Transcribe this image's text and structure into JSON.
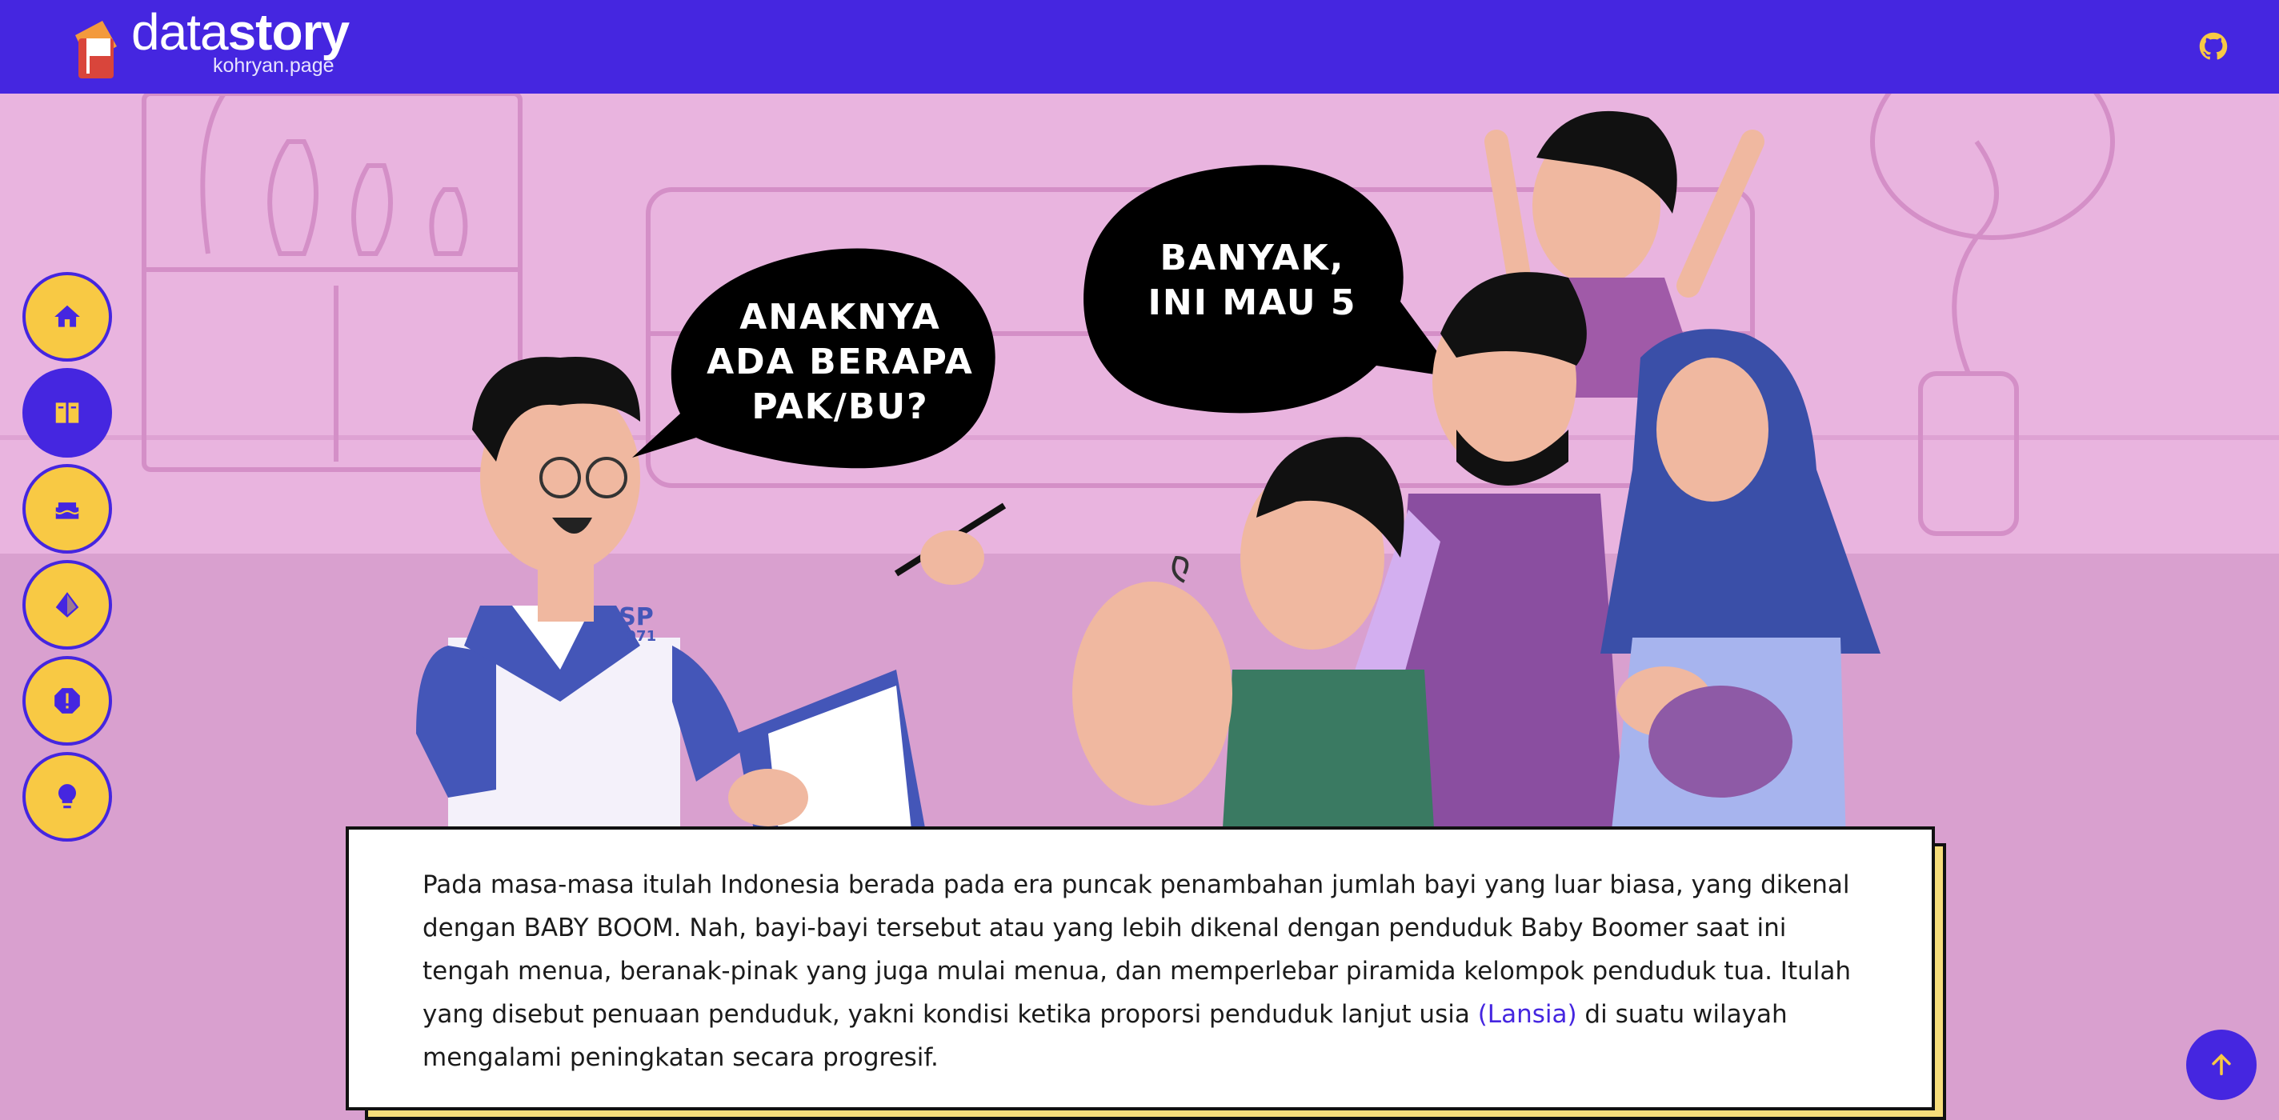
{
  "header": {
    "brand_light": "data",
    "brand_bold": "story",
    "tagline": "kohryan.page",
    "github_icon": "github-icon"
  },
  "nav": {
    "items": [
      {
        "icon": "home-icon",
        "active": false
      },
      {
        "icon": "book-icon",
        "active": true
      },
      {
        "icon": "cake-icon",
        "active": false
      },
      {
        "icon": "pyramid-icon",
        "active": false
      },
      {
        "icon": "alert-icon",
        "active": false
      },
      {
        "icon": "lightbulb-icon",
        "active": false
      }
    ]
  },
  "scene": {
    "bubble_left": "ANAKNYA\nADA BERAPA\nPAK/BU?",
    "bubble_right": "BANYAK,\nINI MAU 5",
    "shirt_text_1": "SP",
    "shirt_text_2": "1971"
  },
  "story": {
    "text_before": "Pada masa-masa itulah Indonesia berada pada era puncak penambahan jumlah bayi yang luar biasa, yang dikenal dengan BABY BOOM. Nah, bayi-bayi tersebut atau yang lebih dikenal dengan penduduk Baby Boomer saat ini tengah menua, beranak-pinak yang juga mulai menua, dan memperlebar piramida kelompok penduduk tua. Itulah yang disebut penuaan penduduk, yakni kondisi ketika proporsi penduduk lanjut usia ",
    "highlight": "(Lansia)",
    "text_after": " di suatu wilayah mengalami peningkatan secara progresif."
  },
  "colors": {
    "header": "#4526e0",
    "wall": "#e9b4df",
    "floor": "#d9a0cf",
    "nav_yellow": "#f8c944",
    "card_shadow": "#f6dd7a"
  }
}
